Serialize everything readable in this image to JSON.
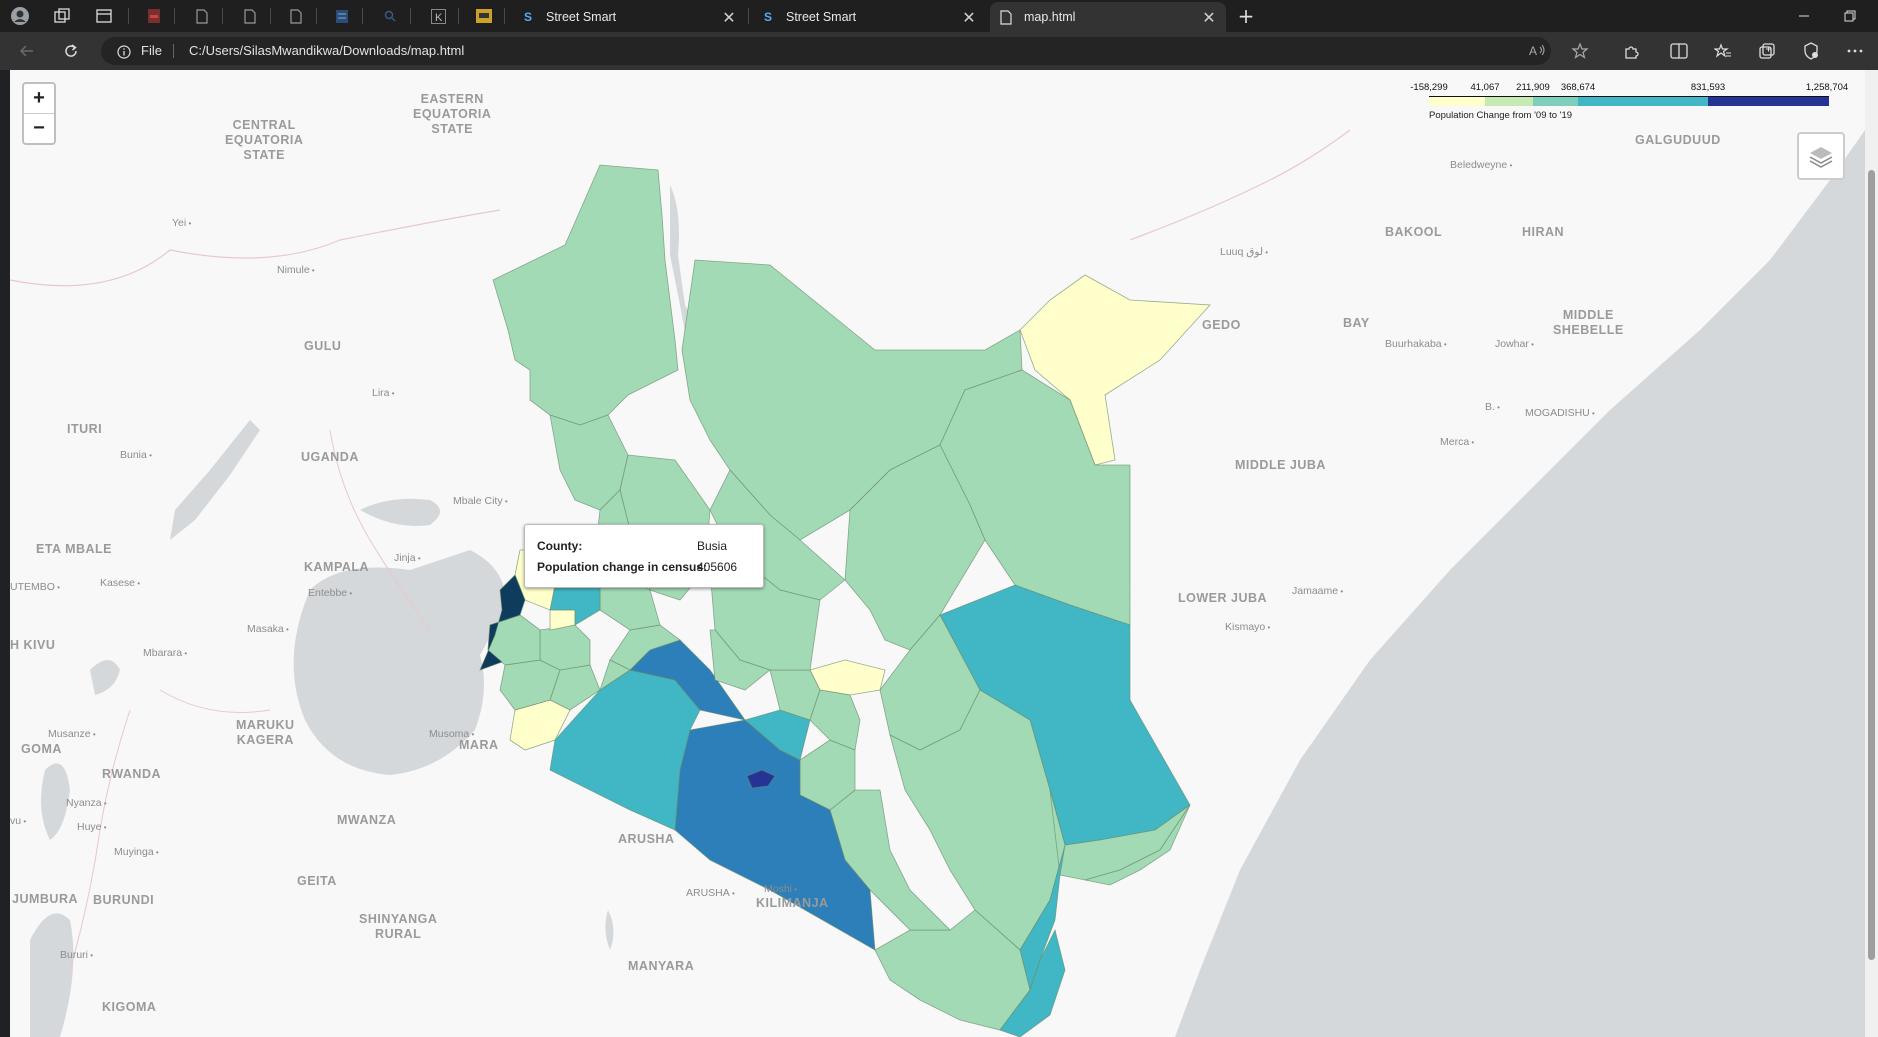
{
  "browser": {
    "tabs": [
      {
        "label": "Street Smart",
        "favicon": "S",
        "active": false
      },
      {
        "label": "Street Smart",
        "favicon": "S",
        "active": false
      },
      {
        "label": "map.html",
        "favicon": "page-icon",
        "active": true
      }
    ],
    "close_symbol": "✕",
    "new_tab_symbol": "+",
    "address": {
      "scheme_label": "File",
      "url": "C:/Users/SilasMwandikwa/Downloads/map.html"
    }
  },
  "map": {
    "zoom_in": "+",
    "zoom_out": "−",
    "legend": {
      "ticks": [
        "-158,299",
        "41,067",
        "211,909",
        "368,674",
        "831,593",
        "1,258,704"
      ],
      "caption": "Population Change from '09 to '19",
      "colors": [
        "#ffffcc",
        "#a1dab4",
        "#41b6c4",
        "#2c7fb8",
        "#253494"
      ]
    },
    "tooltip": {
      "county_label": "County:",
      "county_value": "Busia",
      "change_label": "Population change in census:",
      "change_value": "405606"
    },
    "labels": {
      "eastern_equatoria": "EASTERN\nEQUATORIA\nSTATE",
      "central_equatoria": "CENTRAL\nEQUATORIA\nSTATE",
      "galguduud": "GALGUDUUD",
      "beledweyne": "Beledweyne",
      "bakool": "BAKOOL",
      "hiran": "HIRAN",
      "luuq": "Luuq لوق",
      "gedo": "GEDO",
      "bay": "BAY",
      "middle_shebelle": "MIDDLE\nSHEBELLE",
      "buurhakaba": "Buurhakaba",
      "jowhar": "Jowhar",
      "b": "B.",
      "mogadishu": "MOGADISHU",
      "merca": "Merca",
      "middle_juba": "MIDDLE JUBA",
      "lower_juba": "LOWER JUBA",
      "jamaame": "Jamaame",
      "kismayo": "Kismayo",
      "yei": "Yei",
      "nimule": "Nimule",
      "gulu": "GULU",
      "lira": "Lira",
      "ituri": "ITURI",
      "uganda": "UGANDA",
      "bunia": "Bunia",
      "mbale": "Mbale City",
      "eta_mbale": "ETA MBALE",
      "kampala": "KAMPALA",
      "jinja": "Jinja",
      "entebbe": "Entebbe",
      "utembo": "UTEMBO",
      "kasese": "Kasese",
      "h_kivu": "H KIVU",
      "masaka": "Masaka",
      "mbarara": "Mbarara",
      "maruku": "MARUKU\nKAGERA",
      "musoma": "Musoma",
      "mara": "MARA",
      "musanze": "Musanze",
      "goma": "GOMA",
      "rwanda": "RWANDA",
      "nyanza": "Nyanza",
      "huye": "Huye",
      "mwanza": "MWANZA",
      "vu": "vu",
      "muyinga": "Muyinga",
      "arusha_region": "ARUSHA",
      "jumbura": "JUMBURA",
      "burundi": "BURUNDI",
      "geita": "GEITA",
      "arusha_city": "ARUSHA",
      "moshi": "Moshi",
      "kilimanjaro": "KILIMANJA",
      "shinyanga": "SHINYANGA\nRURAL",
      "bururi": "Bururi",
      "manyara": "MANYARA",
      "kigoma": "KIGOMA"
    }
  }
}
